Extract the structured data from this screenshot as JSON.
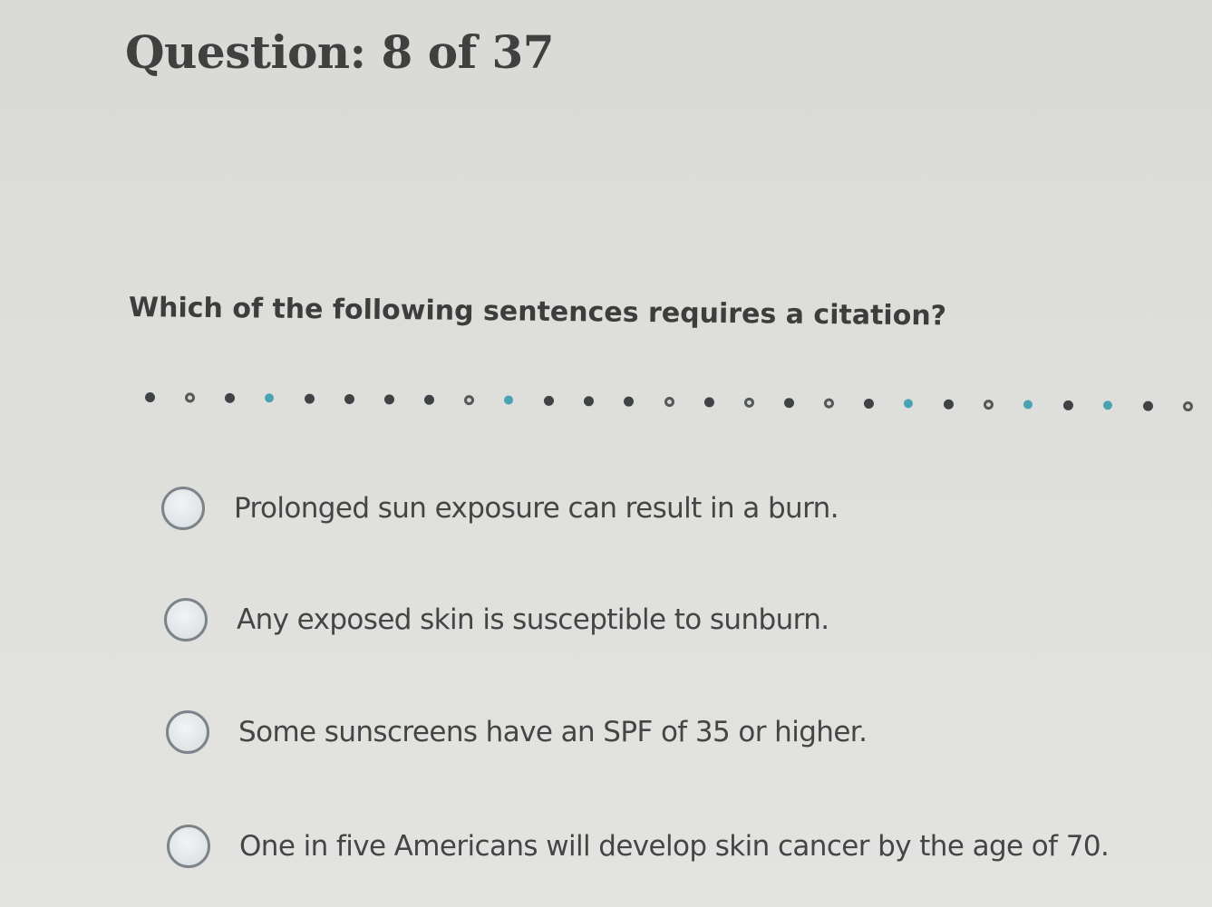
{
  "header": {
    "title": "Question: 8 of 37"
  },
  "question": {
    "prompt": "Which of the following sentences requires a citation?"
  },
  "divider": {
    "dots": [
      "filled",
      "open",
      "filled",
      "teal",
      "filled",
      "filled",
      "filled",
      "filled",
      "open",
      "teal",
      "filled",
      "filled",
      "filled",
      "open",
      "filled",
      "open",
      "filled",
      "open",
      "filled",
      "teal",
      "filled",
      "open",
      "teal",
      "filled",
      "teal",
      "filled",
      "open"
    ]
  },
  "options": [
    {
      "label": "Prolonged sun exposure can result in a burn.",
      "selected": false
    },
    {
      "label": "Any exposed skin is susceptible to sunburn.",
      "selected": false
    },
    {
      "label": "Some sunscreens have an SPF of 35 or higher.",
      "selected": false
    },
    {
      "label": "One in five Americans will develop skin cancer by the age of 70.",
      "selected": false
    }
  ],
  "colors": {
    "accent_dot": "#4aa3b1",
    "text": "#3c3d3d",
    "radio_border": "#7d8489"
  }
}
